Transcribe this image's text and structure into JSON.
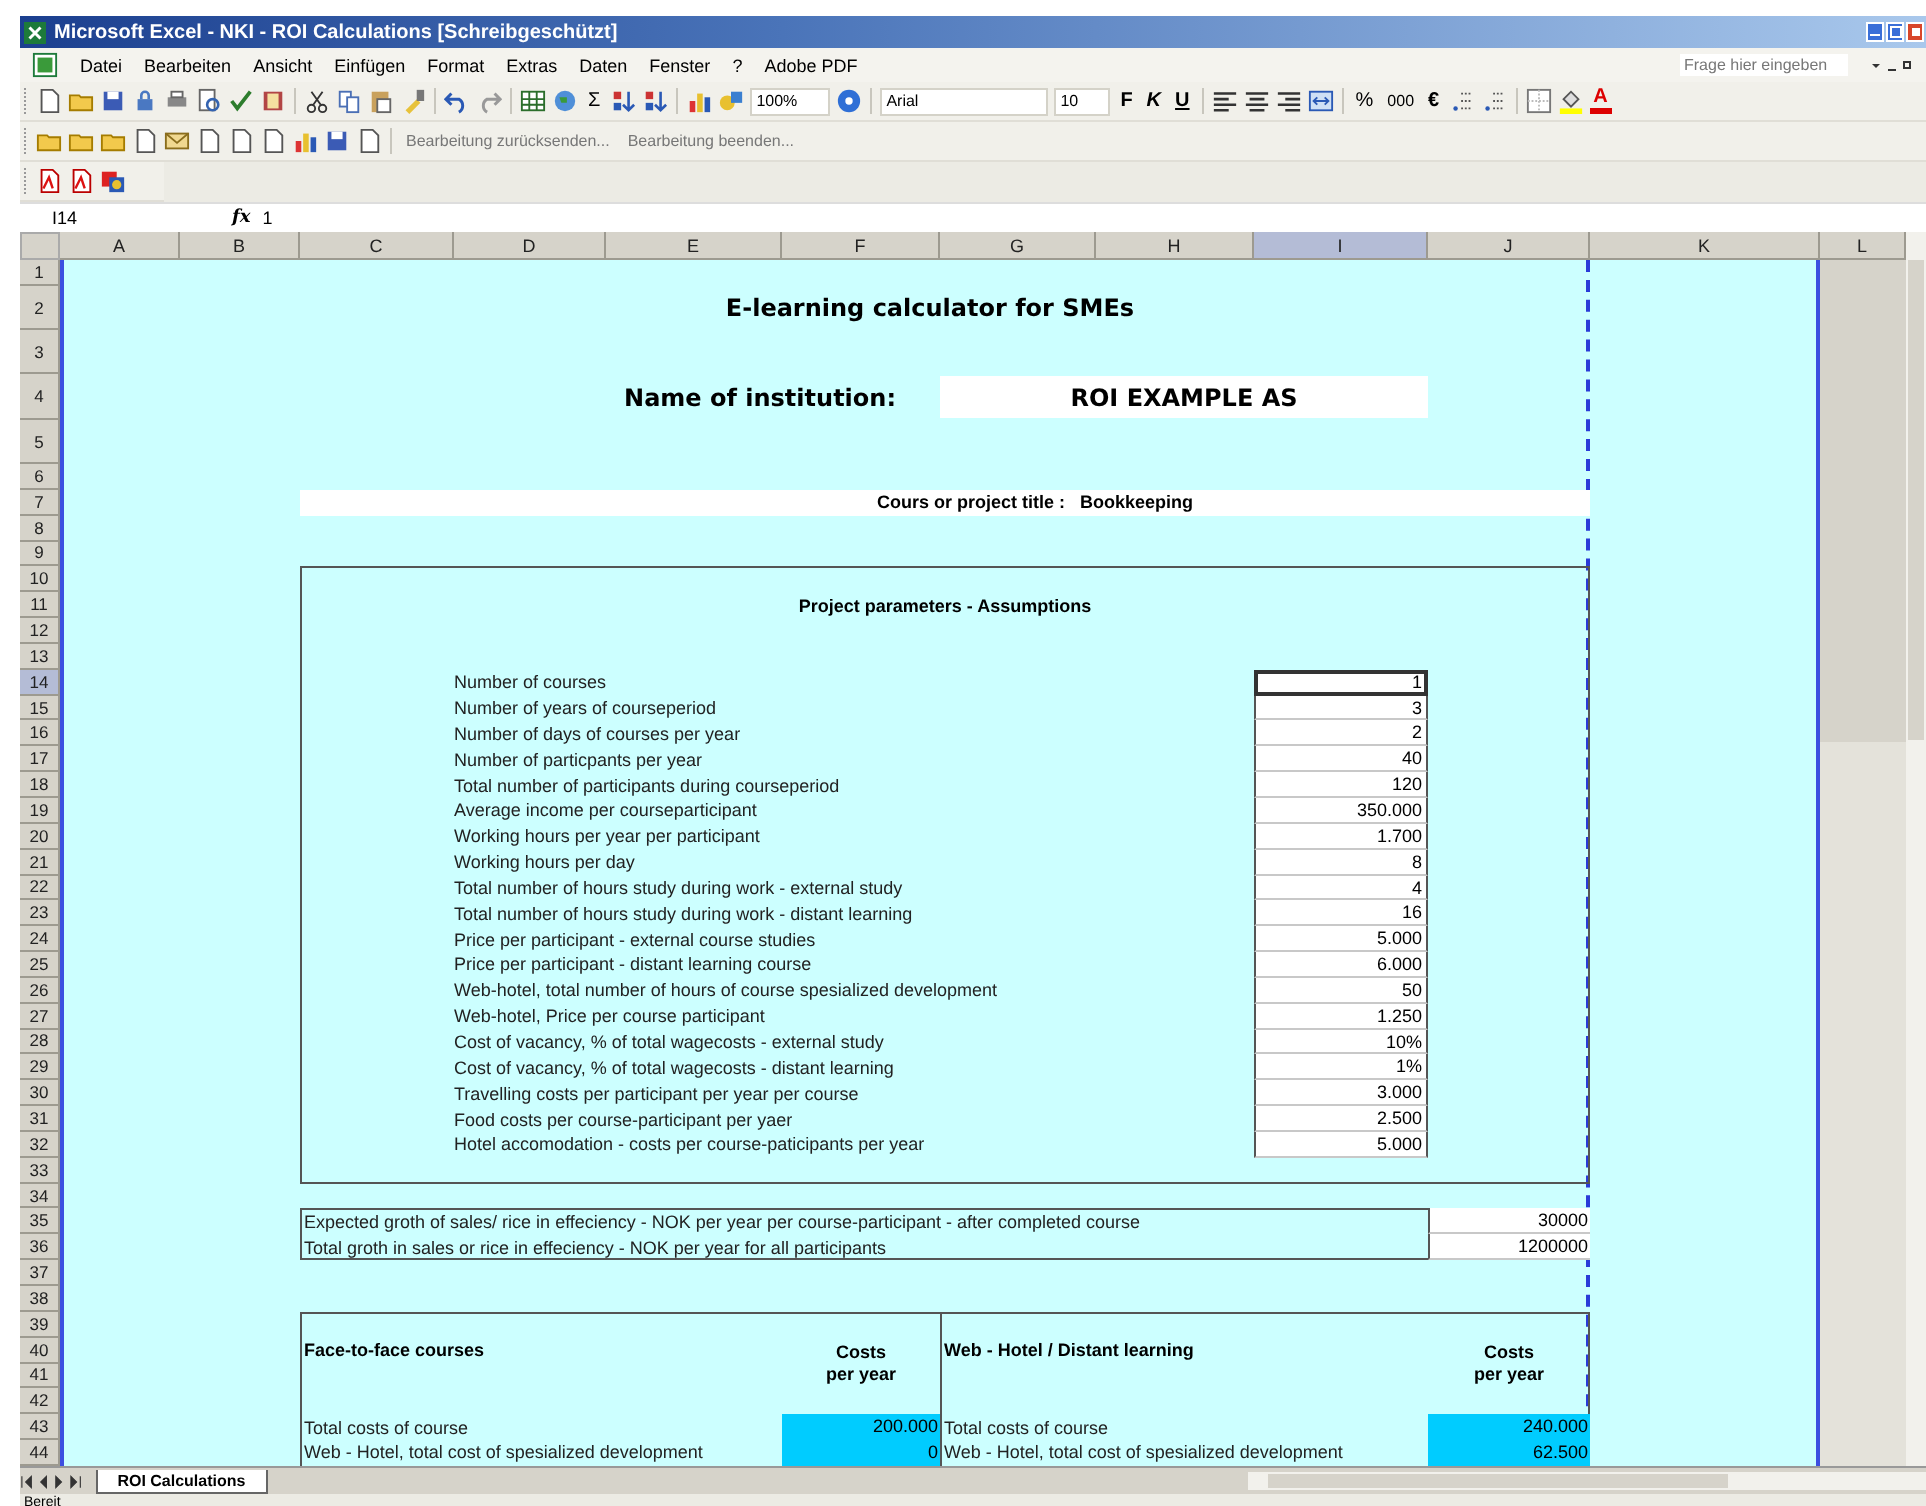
{
  "window": {
    "title": "Microsoft Excel - NKI - ROI Calculations [Schreibgeschützt]"
  },
  "menu": [
    "Datei",
    "Bearbeiten",
    "Ansicht",
    "Einfügen",
    "Format",
    "Extras",
    "Daten",
    "Fenster",
    "?",
    "Adobe PDF"
  ],
  "help_search": {
    "placeholder": "Frage hier eingeben"
  },
  "toolbar": {
    "sum": "Σ",
    "zoom": "100%",
    "font": "Arial",
    "font_size": "10",
    "bold": "F",
    "italic": "K",
    "underline": "U",
    "percent": "%",
    "thousands": "000",
    "euro": "€",
    "font_color": "A"
  },
  "review_toolbar": {
    "buttons": [
      "Bearbeitung zurücksenden...",
      "Bearbeitung beenden..."
    ]
  },
  "formula_bar": {
    "name_box": "I14",
    "function_label": "fx",
    "value": "1"
  },
  "columns": [
    {
      "label": "A",
      "selected": false
    },
    {
      "label": "B",
      "selected": false
    },
    {
      "label": "C",
      "selected": false
    },
    {
      "label": "D",
      "selected": false
    },
    {
      "label": "E",
      "selected": false
    },
    {
      "label": "F",
      "selected": false
    },
    {
      "label": "G",
      "selected": false
    },
    {
      "label": "H",
      "selected": false
    },
    {
      "label": "I",
      "selected": true
    },
    {
      "label": "J",
      "selected": false
    },
    {
      "label": "K",
      "selected": false
    },
    {
      "label": "L",
      "selected": false
    }
  ],
  "rows": [
    {
      "label": "1",
      "selected": false
    },
    {
      "label": "2",
      "selected": false
    },
    {
      "label": "3",
      "selected": false
    },
    {
      "label": "4",
      "selected": false
    },
    {
      "label": "5",
      "selected": false
    },
    {
      "label": "6",
      "selected": false
    },
    {
      "label": "7",
      "selected": false
    },
    {
      "label": "8",
      "selected": false
    },
    {
      "label": "9",
      "selected": false
    },
    {
      "label": "10",
      "selected": false
    },
    {
      "label": "11",
      "selected": false
    },
    {
      "label": "12",
      "selected": false
    },
    {
      "label": "13",
      "selected": false
    },
    {
      "label": "14",
      "selected": true
    },
    {
      "label": "15",
      "selected": false
    },
    {
      "label": "16",
      "selected": false
    },
    {
      "label": "17",
      "selected": false
    },
    {
      "label": "18",
      "selected": false
    },
    {
      "label": "19",
      "selected": false
    },
    {
      "label": "20",
      "selected": false
    },
    {
      "label": "21",
      "selected": false
    },
    {
      "label": "22",
      "selected": false
    },
    {
      "label": "23",
      "selected": false
    },
    {
      "label": "24",
      "selected": false
    },
    {
      "label": "25",
      "selected": false
    },
    {
      "label": "26",
      "selected": false
    },
    {
      "label": "27",
      "selected": false
    },
    {
      "label": "28",
      "selected": false
    },
    {
      "label": "29",
      "selected": false
    },
    {
      "label": "30",
      "selected": false
    },
    {
      "label": "31",
      "selected": false
    },
    {
      "label": "32",
      "selected": false
    },
    {
      "label": "33",
      "selected": false
    },
    {
      "label": "34",
      "selected": false
    },
    {
      "label": "35",
      "selected": false
    },
    {
      "label": "36",
      "selected": false
    },
    {
      "label": "37",
      "selected": false
    },
    {
      "label": "38",
      "selected": false
    },
    {
      "label": "39",
      "selected": false
    },
    {
      "label": "40",
      "selected": false
    },
    {
      "label": "41",
      "selected": false
    },
    {
      "label": "42",
      "selected": false
    },
    {
      "label": "43",
      "selected": false
    },
    {
      "label": "44",
      "selected": false
    }
  ],
  "sheet": {
    "title": "E-learning calculator for SMEs",
    "institution_label": "Name of institution:",
    "institution": "ROI EXAMPLE AS",
    "course_title": {
      "label": "Cours or project title :",
      "value": "Bookkeeping"
    },
    "parameters": {
      "heading": "Project parameters - Assumptions",
      "items": [
        {
          "label": "Number of courses",
          "value": "1",
          "selected": true
        },
        {
          "label": "Number of years of courseperiod",
          "value": "3",
          "selected": false
        },
        {
          "label": "Number of days of courses per year",
          "value": "2",
          "selected": false
        },
        {
          "label": "Number of particpants per year",
          "value": "40",
          "selected": false
        },
        {
          "label": "Total number of participants during courseperiod",
          "value": "120",
          "selected": false
        },
        {
          "label": "Average income per courseparticipant",
          "value": "350.000",
          "selected": false
        },
        {
          "label": "Working hours per year per participant",
          "value": "1.700",
          "selected": false
        },
        {
          "label": "Working hours per day",
          "value": "8",
          "selected": false
        },
        {
          "label": "Total number of hours study during work - external study",
          "value": "4",
          "selected": false
        },
        {
          "label": "Total number of hours study during work - distant learning",
          "value": "16",
          "selected": false
        },
        {
          "label": "Price per participant - external course studies",
          "value": "5.000",
          "selected": false
        },
        {
          "label": "Price per participant - distant learning course",
          "value": "6.000",
          "selected": false
        },
        {
          "label": "Web-hotel, total number of hours of course spesialized development",
          "value": "50",
          "selected": false
        },
        {
          "label": "Web-hotel, Price per course participant",
          "value": "1.250",
          "selected": false
        },
        {
          "label": "Cost of vacancy, % of total wagecosts - external study",
          "value": "10%",
          "selected": false
        },
        {
          "label": "Cost of vacancy, % of total wagecosts - distant learning",
          "value": "1%",
          "selected": false
        },
        {
          "label": "Travelling costs per participant per year per course",
          "value": "3.000",
          "selected": false
        },
        {
          "label": "Food costs per course-participant per yaer",
          "value": "2.500",
          "selected": false
        },
        {
          "label": "Hotel accomodation - costs per course-paticipants per year",
          "value": "5.000",
          "selected": false
        }
      ]
    },
    "growth": [
      {
        "label": "Expected groth of sales/ rice in effeciency - NOK per year per course-participant - after completed course",
        "value": "30000"
      },
      {
        "label": "Total groth in sales or rice in effeciency - NOK per year for all participants",
        "value": "1200000"
      }
    ],
    "cost_sections": [
      {
        "heading": "Face-to-face courses",
        "costs_heading": [
          "Costs",
          "per year"
        ],
        "rows": [
          {
            "label": "Total costs of course",
            "value": "200.000"
          },
          {
            "label": "Web - Hotel, total cost of spesialized development",
            "value": "0"
          }
        ]
      },
      {
        "heading": "Web - Hotel / Distant learning",
        "costs_heading": [
          "Costs",
          "per year"
        ],
        "rows": [
          {
            "label": "Total costs of course",
            "value": "240.000"
          },
          {
            "label": "Web - Hotel, total cost of spesialized development",
            "value": "62.500"
          }
        ]
      }
    ]
  },
  "sheet_tabs": [
    {
      "label": "ROI Calculations",
      "selected": true
    }
  ],
  "status_bar": "Bereit"
}
